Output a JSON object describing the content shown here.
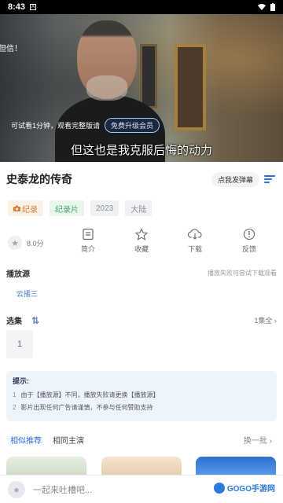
{
  "status_bar": {
    "time": "8:43",
    "notif_icon": "A"
  },
  "video": {
    "left_text": "但信！",
    "trial_text": "可试看1分钟，观看完整版请",
    "trial_button": "免费升级会员",
    "subtitle": "但这也是我克服后悔的动力"
  },
  "detail": {
    "title": "史泰龙的传奇",
    "danmu_button": "点我发弹幕",
    "tags": [
      "纪录",
      "纪录片",
      "2023",
      "大陆"
    ],
    "rating": "8.0分",
    "actions": [
      "简介",
      "收藏",
      "下载",
      "反馈"
    ]
  },
  "source": {
    "label": "播放源",
    "hint": "播放失败可尝试下载观看",
    "items": [
      "云播三"
    ]
  },
  "episodes": {
    "label": "选集",
    "count": "1集全",
    "items": [
      "1"
    ]
  },
  "tips": {
    "title": "提示:",
    "lines": [
      "由于【播放源】不同，播放失败请更换【播放源】",
      "影片出现任何广告请谨慎，不参与任何赞助支持"
    ]
  },
  "recommend": {
    "tabs": [
      "相似推荐",
      "相同主演"
    ],
    "refresh": "换一批"
  },
  "bottom_bar": {
    "comment_placeholder": "一起来吐槽吧...",
    "logo_text": "GOGO手游网"
  },
  "colors": {
    "accent": "#2d6cdf",
    "tag_orange": "#d5803d",
    "tag_green": "#45a968"
  }
}
